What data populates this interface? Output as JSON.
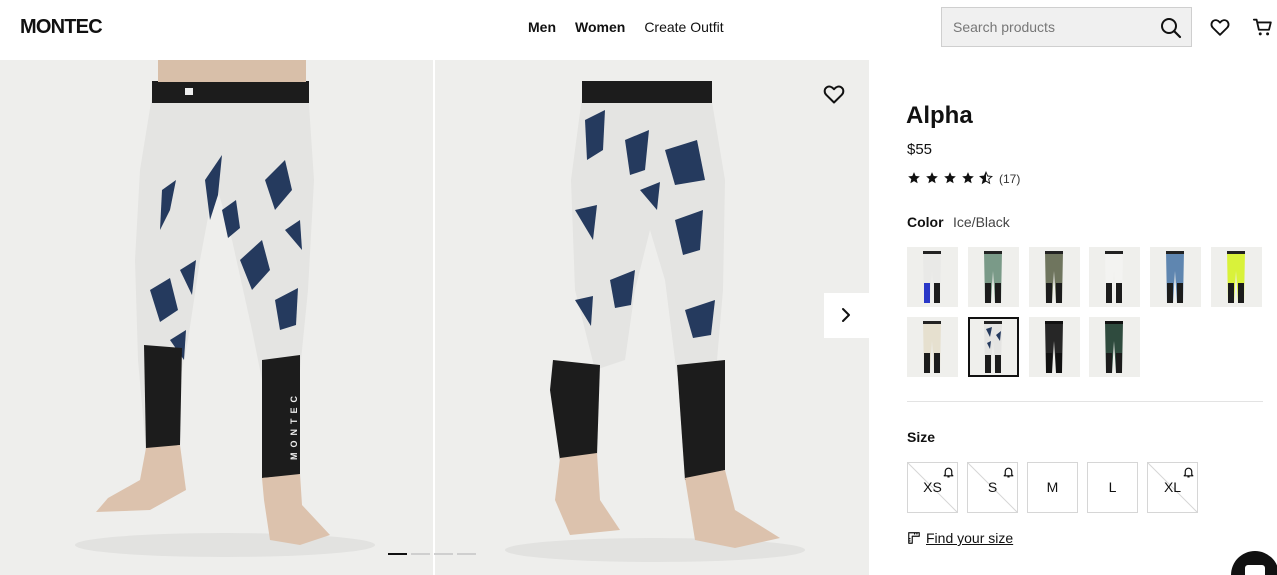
{
  "header": {
    "logo": "MONTEC",
    "nav": {
      "men": "Men",
      "women": "Women",
      "create_outfit": "Create Outfit"
    },
    "search_placeholder": "Search products",
    "icons": [
      "search-icon",
      "heart-icon",
      "cart-icon"
    ]
  },
  "gallery": {
    "image_text": "MONTEC",
    "slide_count": 4,
    "active_slide": 1,
    "icons": [
      "wishlist-heart-icon",
      "chevron-right-icon"
    ]
  },
  "product": {
    "name": "Alpha",
    "price": "$55",
    "rating": 4.5,
    "rating_max": 5,
    "review_count": "(17)",
    "color_label": "Color",
    "color_value": "Ice/Black",
    "swatch_count": 10,
    "selected_swatch": 7,
    "size_label": "Size",
    "sizes": [
      {
        "label": "XS",
        "in_stock": false
      },
      {
        "label": "S",
        "in_stock": false
      },
      {
        "label": "M",
        "in_stock": true
      },
      {
        "label": "L",
        "in_stock": true
      },
      {
        "label": "XL",
        "in_stock": false
      }
    ],
    "find_size": "Find your size"
  },
  "colors": {
    "text": "#111111",
    "photo_bg": "#eeeeec",
    "ice": "#e4e4e2",
    "navy_pattern": "#253a5e",
    "cuff": "#1c1c1c"
  }
}
